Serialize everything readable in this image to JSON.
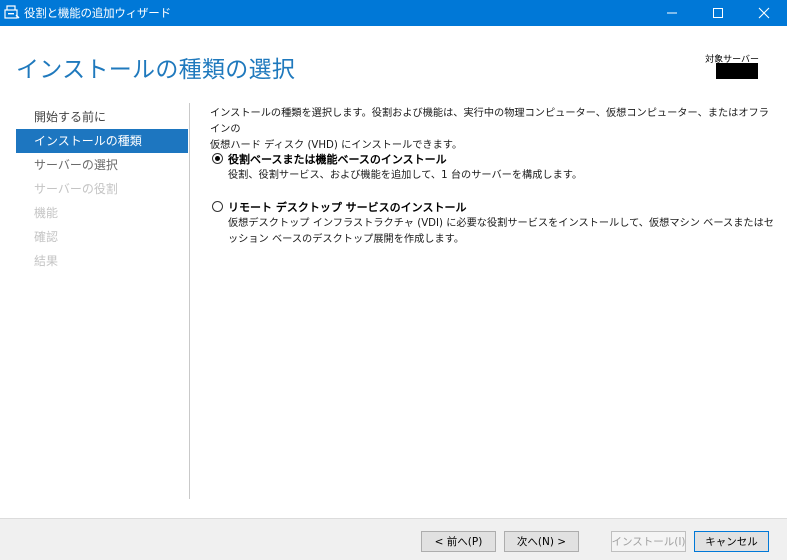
{
  "window": {
    "title": "役割と機能の追加ウィザード",
    "accent_color": "#0078d7"
  },
  "header": {
    "page_title": "インストールの種類の選択",
    "target_server_label": "対象サーバー",
    "target_server_value": ""
  },
  "nav": {
    "items": [
      {
        "label": "開始する前に",
        "state": "normal"
      },
      {
        "label": "インストールの種類",
        "state": "selected"
      },
      {
        "label": "サーバーの選択",
        "state": "subtle"
      },
      {
        "label": "サーバーの役割",
        "state": "disabled"
      },
      {
        "label": "機能",
        "state": "disabled"
      },
      {
        "label": "確認",
        "state": "disabled"
      },
      {
        "label": "結果",
        "state": "disabled"
      }
    ]
  },
  "main": {
    "description_line1": "インストールの種類を選択します。役割および機能は、実行中の物理コンピューター、仮想コンピューター、またはオフラインの",
    "description_line2": "仮想ハード ディスク (VHD) にインストールできます。",
    "options": [
      {
        "label": "役割ベースまたは機能ベースのインストール",
        "description": "役割、役割サービス、および機能を追加して、1 台のサーバーを構成します。",
        "selected": true
      },
      {
        "label": "リモート デスクトップ サービスのインストール",
        "description": "仮想デスクトップ インフラストラクチャ (VDI) に必要な役割サービスをインストールして、仮想マシン ベースまたはセッション ベースのデスクトップ展開を作成します。",
        "selected": false
      }
    ]
  },
  "footer": {
    "prev_label": "< 前へ(P)",
    "next_label": "次へ(N) >",
    "install_label": "インストール(I)",
    "cancel_label": "キャンセル"
  }
}
